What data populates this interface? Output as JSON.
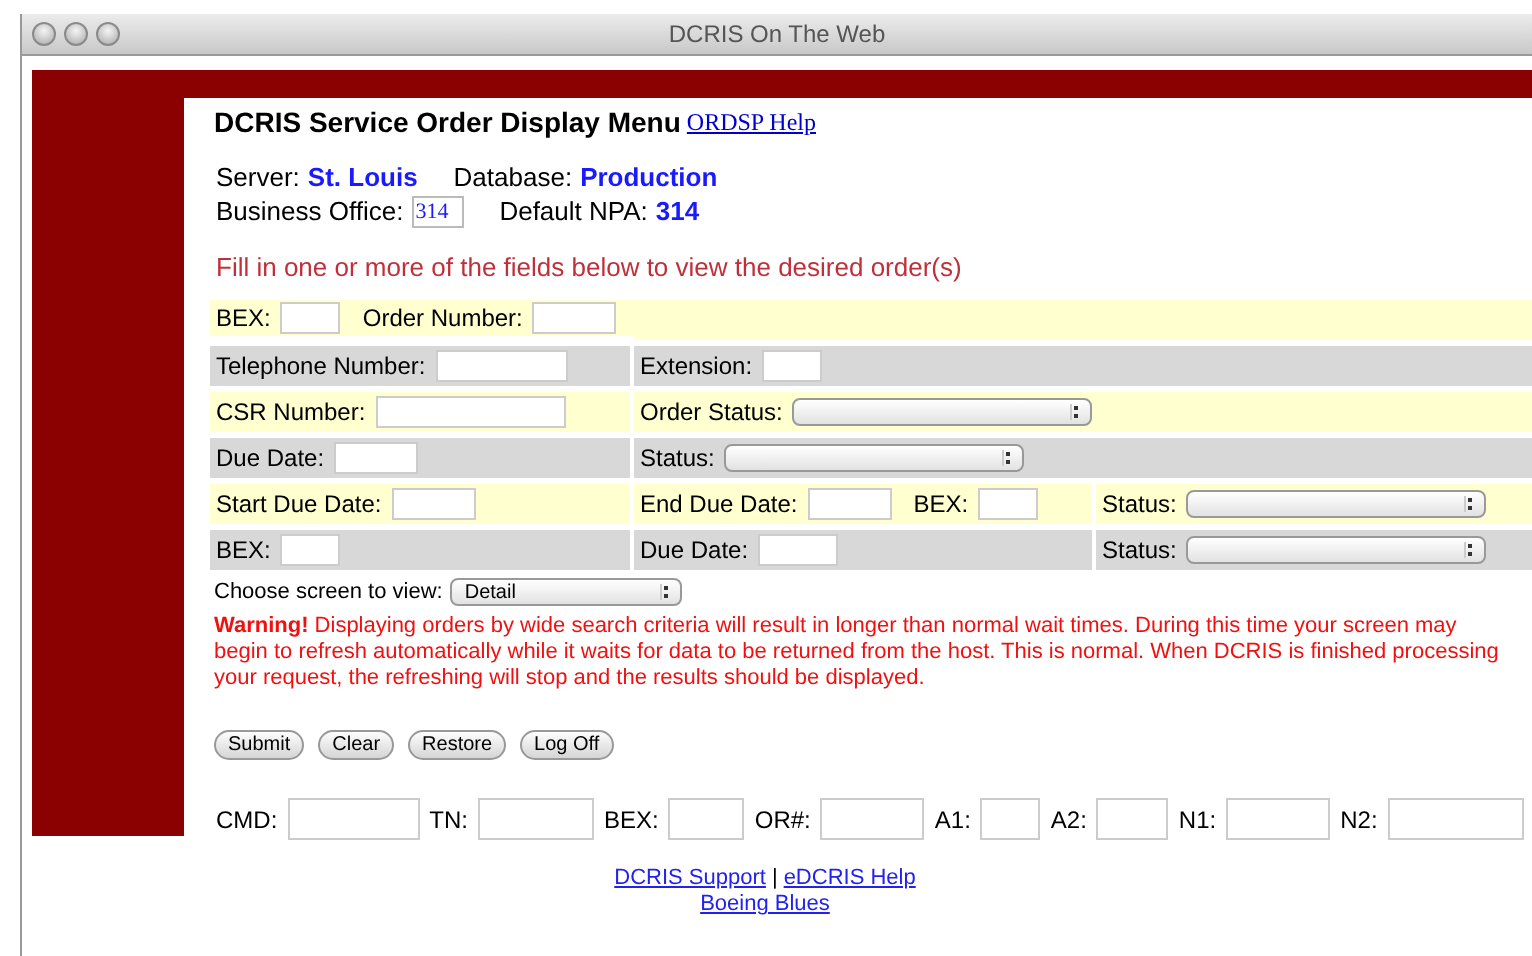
{
  "window": {
    "title": "DCRIS On The Web"
  },
  "header": {
    "title": "DCRIS Service Order Display Menu",
    "help_link": "ORDSP Help"
  },
  "info": {
    "server_label": "Server:",
    "server": "St. Louis",
    "database_label": "Database:",
    "database": "Production",
    "office_label": "Business Office:",
    "office": "314",
    "npa_label": "Default NPA:",
    "npa": "314"
  },
  "instruction": "Fill in one or more of the fields below to view the desired order(s)",
  "form_rows": [
    {
      "cells": [
        {
          "fields": [
            {
              "kind": "text",
              "label": "BEX:"
            },
            {
              "kind": "text",
              "label": "Order Number:"
            }
          ]
        }
      ]
    },
    {
      "cells": [
        {
          "fields": [
            {
              "kind": "text",
              "label": "Telephone Number:"
            }
          ]
        },
        {
          "fields": [
            {
              "kind": "text",
              "label": "Extension:"
            }
          ]
        }
      ]
    },
    {
      "cells": [
        {
          "fields": [
            {
              "kind": "text",
              "label": "CSR Number:"
            }
          ]
        },
        {
          "fields": [
            {
              "kind": "select",
              "label": "Order Status:"
            }
          ]
        }
      ]
    },
    {
      "cells": [
        {
          "fields": [
            {
              "kind": "text",
              "label": "Due Date:"
            }
          ]
        },
        {
          "fields": [
            {
              "kind": "select",
              "label": "Status:"
            }
          ]
        }
      ]
    },
    {
      "cells": [
        {
          "fields": [
            {
              "kind": "text",
              "label": "Start Due Date:"
            }
          ]
        },
        {
          "fields": [
            {
              "kind": "text",
              "label": "End Due Date:"
            },
            {
              "kind": "text",
              "label": "BEX:"
            }
          ]
        },
        {
          "fields": [
            {
              "kind": "select",
              "label": "Status:"
            }
          ]
        }
      ]
    },
    {
      "cells": [
        {
          "fields": [
            {
              "kind": "text",
              "label": "BEX:"
            }
          ]
        },
        {
          "fields": [
            {
              "kind": "text",
              "label": "Due Date:"
            }
          ]
        },
        {
          "fields": [
            {
              "kind": "select",
              "label": "Status:"
            }
          ]
        }
      ]
    }
  ],
  "screen_choice": {
    "label": "Choose screen to view:",
    "value": "Detail"
  },
  "warning": "**Warning!** Displaying orders by wide search criteria will result in longer than normal wait times. During this time your screen may begin to refresh automatically while it waits for data to be returned from the host. This is normal. When DCRIS is finished processing your request, the refreshing will stop and the results should be displayed.",
  "buttons": [
    "Submit",
    "Clear",
    "Restore",
    "Log Off"
  ],
  "command_line": [
    "CMD:",
    "TN:",
    "BEX:",
    "OR#:",
    "A1:",
    "A2:",
    "N1:",
    "N2:"
  ],
  "footer_links": [
    {
      "label": "DCRIS Support"
    },
    {
      "label": "eDCRIS Help"
    },
    {
      "label": "Boeing Blues"
    }
  ],
  "footer_separator": "|"
}
